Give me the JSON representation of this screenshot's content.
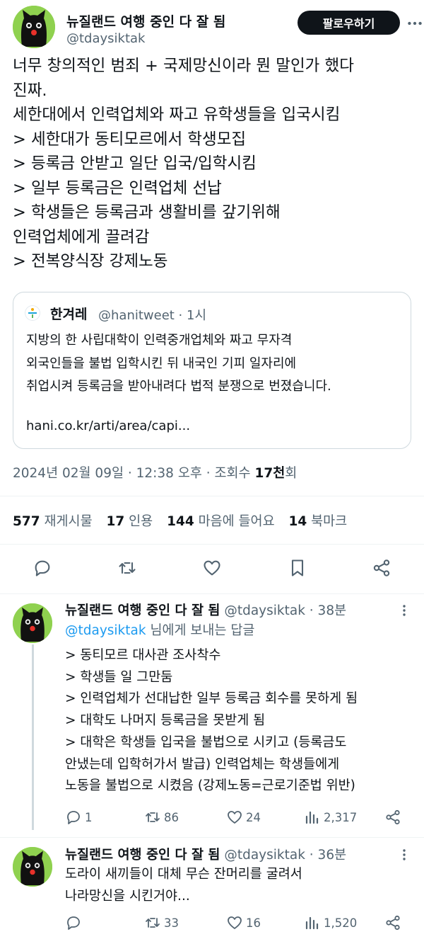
{
  "main": {
    "author_name": "뉴질랜드 여행 중인 다 잘 됨",
    "author_handle": "@tdaysiktak",
    "follow_label": "팔로우하기",
    "body_lines": [
      "너무 창의적인 범죄 + 국제망신이라 뭔 말인가 했다",
      "진짜.",
      "세한대에서 인력업체와 짜고 유학생들을 입국시킴",
      "> 세한대가 동티모르에서 학생모집",
      "> 등록금 안받고 일단 입국/입학시킴",
      "> 일부 등록금은 인력업체 선납",
      "> 학생들은 등록금과 생활비를 갚기위해",
      "인력업체에게 끌려감",
      "> 전복양식장 강제노동"
    ],
    "quote": {
      "source_name": "한겨레",
      "source_meta": "@hanitweet · 1시",
      "body_lines": [
        "지방의 한 사립대학이 인력중개업체와 짜고 무자격",
        "외국인들을 불법 입학시킨 뒤 내국인 기피 일자리에",
        "취업시켜 등록금을 받아내려다 법적 분쟁으로 번졌습니다."
      ],
      "link": "hani.co.kr/arti/area/capi..."
    },
    "timestamp_prefix": "2024년 02월 09일 · 12:38 오후 · 조회수 ",
    "views": "17천",
    "views_suffix": "회",
    "stats": {
      "retweets": "577",
      "retweets_label": "재게시물",
      "quotes": "17",
      "quotes_label": "인용",
      "likes": "144",
      "likes_label": "마음에 들어요",
      "bookmarks": "14",
      "bookmarks_label": "북마크"
    }
  },
  "replies": [
    {
      "name": "뉴질랜드 여행 중인 다 잘 됨",
      "handle_time": "@tdaysiktak · 38분",
      "reply_to_mention": "@tdaysiktak",
      "reply_to_suffix": " 님에게 보내는 답글",
      "body_lines": [
        "> 동티모르 대사관 조사착수",
        "> 학생들 일 그만둠",
        "> 인력업체가 선대납한 일부 등록금 회수를 못하게 됨",
        "> 대학도 나머지 등록금을 못받게 됨",
        "> 대학은 학생들 입국을 불법으로 시키고 (등록금도",
        "안냈는데 입학허가서 발급) 인력업체는 학생들에게",
        "노동을 불법으로 시켰음 (강제노동=근로기준법 위반)"
      ],
      "replies": "1",
      "retweets": "86",
      "likes": "24",
      "views": "2,317"
    },
    {
      "name": "뉴질랜드 여행 중인 다 잘 됨",
      "handle_time": "@tdaysiktak · 36분",
      "body_lines": [
        "도라이 새끼들이 대체 무슨 잔머리를 굴려서",
        "나라망신을 시킨거야..."
      ],
      "replies": "",
      "retweets": "33",
      "likes": "16",
      "views": "1,520"
    }
  ],
  "icons": {
    "reply": "reply-icon",
    "retweet": "retweet-icon",
    "like": "heart-icon",
    "bookmark": "bookmark-icon",
    "share": "share-icon",
    "views": "views-icon",
    "more": "more-icon"
  },
  "colors": {
    "avatar_bg": "#8fd14f",
    "link": "#1d9bf0",
    "muted": "#536471",
    "text": "#0f1419"
  }
}
